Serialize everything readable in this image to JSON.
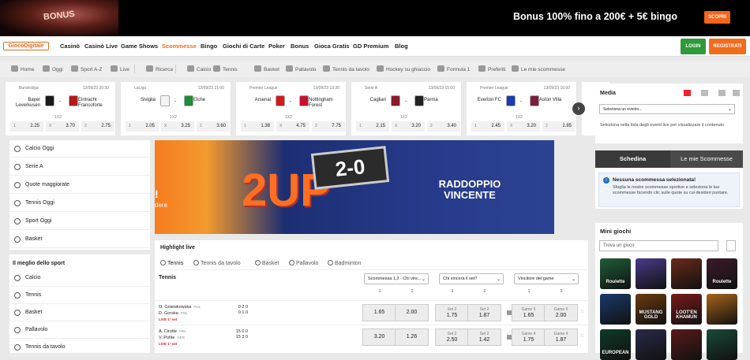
{
  "promo": {
    "image_text": "BONUS",
    "bonus_text": "Bonus 100% fino a 200€ + 5€ bingo",
    "cta": "SCOPRI"
  },
  "nav": {
    "logo": "GiocoDigitale",
    "items": [
      "Casinò",
      "Casinò Live",
      "Game Shows",
      "Scommesse",
      "Bingo",
      "Giochi di Carte",
      "Poker",
      "Bonus",
      "Gioca Gratis",
      "GD Premium",
      "Blog"
    ],
    "active": "Scommesse",
    "login": "LOGIN",
    "register": "REGISTRATI"
  },
  "subnav": [
    "Home",
    "Oggi",
    "Sport A-Z",
    "Live",
    "Ricerca",
    "Calcio",
    "Tennis",
    "Basket",
    "Pallavolo",
    "Tennis da tavolo",
    "Hockey su ghiaccio",
    "Formula 1",
    "Preferiti",
    "Le mie scommesse"
  ],
  "events": [
    {
      "league": "Bundesliga",
      "date": "12/09/23 20:30",
      "home": "Bayer Leverkusen",
      "away": "Eintracht Francoforte",
      "market": "1X2",
      "odds": [
        {
          "l": "1",
          "v": "2.25"
        },
        {
          "l": "X",
          "v": "3.70"
        },
        {
          "l": "2",
          "v": "2.75"
        }
      ],
      "c1": "#1a1a1a",
      "c2": "#b21a1a"
    },
    {
      "league": "LaLiga",
      "date": "12/09/23 21:00",
      "home": "Siviglia",
      "away": "Elche",
      "market": "1X2",
      "odds": [
        {
          "l": "1",
          "v": "2.05"
        },
        {
          "l": "X",
          "v": "3.25"
        },
        {
          "l": "2",
          "v": "3.60"
        }
      ],
      "c1": "#f4f4f4",
      "c2": "#1f8a3a"
    },
    {
      "league": "Premier League",
      "date": "13/09/23 13:30",
      "home": "Arsenal",
      "away": "Nottingham Forest",
      "market": "1X2",
      "odds": [
        {
          "l": "1",
          "v": "1.38"
        },
        {
          "l": "X",
          "v": "4.75"
        },
        {
          "l": "2",
          "v": "7.75"
        }
      ],
      "c1": "#d01b1b",
      "c2": "#c8102e"
    },
    {
      "league": "Serie A",
      "date": "13/09/23 15:00",
      "home": "Cagliari",
      "away": "Parma",
      "market": "1X2",
      "odds": [
        {
          "l": "1",
          "v": "2.15"
        },
        {
          "l": "X",
          "v": "3.20"
        },
        {
          "l": "2",
          "v": "3.40"
        }
      ],
      "c1": "#8a1a2a",
      "c2": "#222222"
    },
    {
      "league": "Premier League",
      "date": "13/09/23 16:00",
      "home": "Everton FC",
      "away": "Aston Villa",
      "market": "1X2",
      "odds": [
        {
          "l": "1",
          "v": "2.45"
        },
        {
          "l": "X",
          "v": "3.20"
        },
        {
          "l": "2",
          "v": "2.85"
        }
      ],
      "c1": "#1c3bb0",
      "c2": "#7a1f3d"
    },
    {
      "league": "La",
      "date": "",
      "home": "",
      "away": "",
      "market": "",
      "odds": [],
      "c1": "#ffffff",
      "c2": "#ffffff"
    }
  ],
  "leftnav": {
    "top": [
      "Calcio Oggi",
      "Serie A",
      "Quote maggiorate",
      "Tennis Oggi",
      "Sport Oggi",
      "Basket"
    ],
    "heading": "Il meglio dello sport",
    "bottom": [
      "Calcio",
      "Tennis",
      "Basket",
      "Pallavolo",
      "Tennis da tavolo"
    ]
  },
  "banner": {
    "side": "!",
    "side_sub": "dere",
    "big": "2UP",
    "score": "2-0",
    "line1": "RADDOPPIO",
    "line2": "VINCENTE"
  },
  "highlight": {
    "title": "Highlight live",
    "tabs": [
      "Tennis",
      "Tennis da tavolo",
      "Basket",
      "Pallavolo",
      "Badminton"
    ],
    "sport": "Tennis",
    "dropdowns": [
      "Scommessa 1,2 - Chi vinc...",
      "Chi vincerà il set?",
      "Vincitore del game"
    ],
    "col_heads": [
      "1",
      "2",
      "1",
      "2",
      "1",
      "2"
    ],
    "matches": [
      {
        "p1": "O. Gniewkowska",
        "n1": "POL",
        "p2": "D. Gorska",
        "n2": "POL",
        "live": "LIVE 1° set",
        "s1": "0 2  0",
        "s2": "0 1  0",
        "odds": [
          {
            "t": "",
            "v": "1.65"
          },
          {
            "t": "",
            "v": "2.00"
          },
          {
            "t": "Set 2",
            "v": "1.75"
          },
          {
            "t": "Set 2",
            "v": "1.87"
          },
          {
            "t": "Game 5",
            "v": "1.65"
          },
          {
            "t": "Game 5",
            "v": "2.00"
          }
        ]
      },
      {
        "p1": "A. Cirotte",
        "n1": "FRA",
        "p2": "V. Pohle",
        "n2": "GER",
        "live": "LIVE 1° set",
        "s1": "15 0  0",
        "s2": "15 2  0",
        "odds": [
          {
            "t": "",
            "v": "3.20"
          },
          {
            "t": "",
            "v": "1.26"
          },
          {
            "t": "Set 2",
            "v": "2.50"
          },
          {
            "t": "Set 2",
            "v": "1.42"
          },
          {
            "t": "Game 4",
            "v": "1.75"
          },
          {
            "t": "Game 4",
            "v": "1.87"
          }
        ]
      }
    ]
  },
  "media": {
    "title": "Media",
    "select": "Seleziona un evento...",
    "desc": "Seleziona nella lista degli eventi live per visualizzare il contenuto"
  },
  "betslip": {
    "tab1": "Schedina",
    "tab2": "Le mie Scommesse",
    "empty_title": "Nessuna scommessa selezionata!",
    "empty_desc": "Sfoglia le nostre scommesse sportive e seleziona le tue scommesse facendo clic sulle quote su cui desideri puntare."
  },
  "minigames": {
    "title": "Mini giochi",
    "placeholder": "Trova un gioco",
    "games": [
      {
        "name": "Roulette",
        "color": "#1f5d3a"
      },
      {
        "name": "",
        "color": "#4a3a8a"
      },
      {
        "name": "",
        "color": "#6a2a1a"
      },
      {
        "name": "Roulette",
        "color": "#3a1a2a"
      },
      {
        "name": "",
        "color": "#1a3a6a"
      },
      {
        "name": "MUSTANG GOLD",
        "color": "#6a3a10"
      },
      {
        "name": "LOOT'EN KHAMUN",
        "color": "#7a1a1a"
      },
      {
        "name": "",
        "color": "#a6641a"
      },
      {
        "name": "EUROPEAN",
        "color": "#0f3a2a"
      },
      {
        "name": "",
        "color": "#2a2a4a"
      },
      {
        "name": "",
        "color": "#5a1a1a"
      },
      {
        "name": "",
        "color": "#1a4a3a"
      }
    ]
  }
}
